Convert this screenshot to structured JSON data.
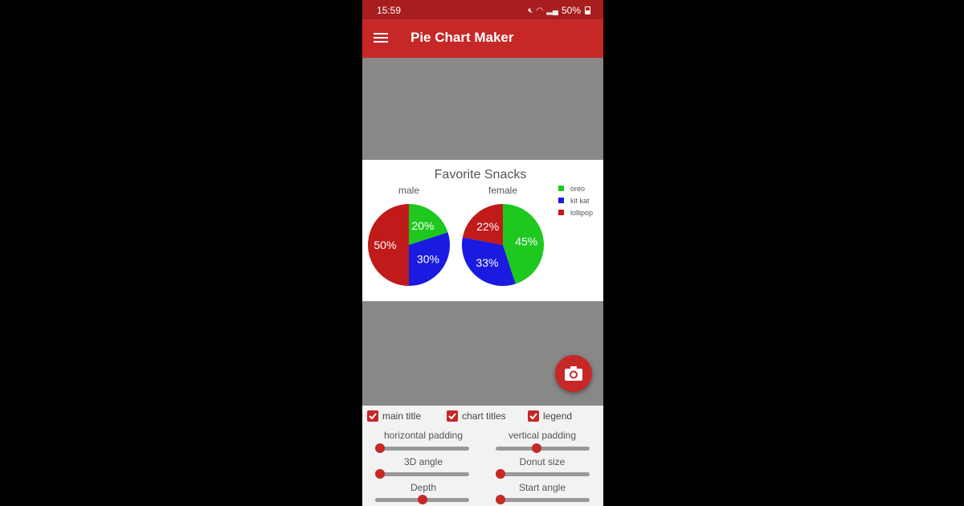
{
  "status": {
    "time": "15:59",
    "battery": "50%"
  },
  "appbar": {
    "title": "Pie Chart Maker"
  },
  "chart_data": {
    "type": "pie",
    "title": "Favorite Snacks",
    "legend_position": "top-right",
    "legend": [
      {
        "label": "oreo",
        "color": "#1ec81e"
      },
      {
        "label": "kit kat",
        "color": "#1a1ae0"
      },
      {
        "label": "lollipop",
        "color": "#c01a1a"
      }
    ],
    "charts": [
      {
        "name": "male",
        "slices": [
          {
            "label": "oreo",
            "value": 20,
            "text": "20%"
          },
          {
            "label": "kit kat",
            "value": 30,
            "text": "30%"
          },
          {
            "label": "lollipop",
            "value": 50,
            "text": "50%"
          }
        ]
      },
      {
        "name": "female",
        "slices": [
          {
            "label": "oreo",
            "value": 45,
            "text": "45%"
          },
          {
            "label": "kit kat",
            "value": 33,
            "text": "33%"
          },
          {
            "label": "lollipop",
            "value": 22,
            "text": "22%"
          }
        ]
      }
    ]
  },
  "controls": {
    "checkboxes": [
      {
        "label": "main title",
        "checked": true
      },
      {
        "label": "chart titles",
        "checked": true
      },
      {
        "label": "legend",
        "checked": true
      }
    ],
    "sliders": [
      {
        "label": "horizontal padding",
        "value": 0.0
      },
      {
        "label": "vertical padding",
        "value": 0.43
      },
      {
        "label": "3D angle",
        "value": 0.0
      },
      {
        "label": "Donut size",
        "value": 0.0
      },
      {
        "label": "Depth",
        "value": 0.5
      },
      {
        "label": "Start angle",
        "value": 0.0
      }
    ]
  },
  "icons": {
    "menu": "hamburger-icon",
    "camera": "camera-icon"
  }
}
